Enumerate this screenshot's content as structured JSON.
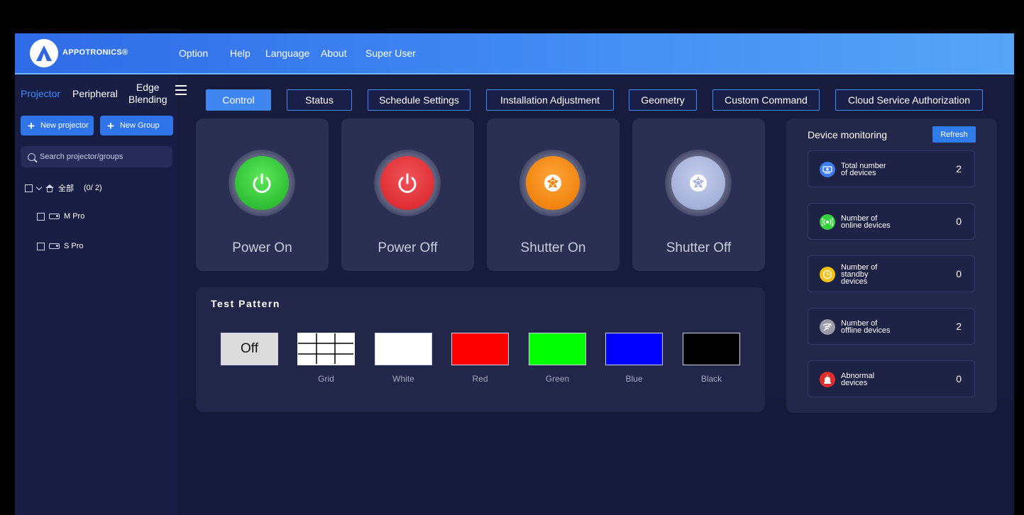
{
  "brand": {
    "name": "APPOTRONICS®"
  },
  "menu": [
    "Option",
    "Help",
    "Language",
    "About",
    "Super User"
  ],
  "sidebar": {
    "tabs": {
      "projector": "Projector",
      "peripheral": "Peripheral",
      "edge_1": "Edge",
      "edge_2": "Blending"
    },
    "new_projector": "New projector",
    "new_group": "New Group",
    "search_placeholder": "Search projector/groups",
    "tree": {
      "group_name": "全部",
      "group_count": "(0/ 2)",
      "items": [
        "M Pro",
        "S Pro"
      ]
    }
  },
  "nav_tabs": [
    "Control",
    "Status",
    "Schedule Settings",
    "Installation Adjustment",
    "Geometry",
    "Custom Command",
    "Cloud Service Authorization"
  ],
  "controls": [
    {
      "label": "Power On",
      "color": "#3ecf3e",
      "icon": "power-icon"
    },
    {
      "label": "Power Off",
      "color": "#e23a3a",
      "icon": "power-icon"
    },
    {
      "label": "Shutter On",
      "color": "#f08a12",
      "icon": "shutter-icon"
    },
    {
      "label": "Shutter Off",
      "color": "#aab6db",
      "icon": "shutter-icon"
    }
  ],
  "test_pattern": {
    "title": "Test Pattern",
    "off_label": "Off",
    "patterns": [
      {
        "label": "Grid",
        "color": "#ffffff"
      },
      {
        "label": "White",
        "color": "#ffffff"
      },
      {
        "label": "Red",
        "color": "#ff0000"
      },
      {
        "label": "Green",
        "color": "#00ff00"
      },
      {
        "label": "Blue",
        "color": "#0000ff"
      },
      {
        "label": "Black",
        "color": "#000000"
      }
    ]
  },
  "monitor": {
    "title": "Device monitoring",
    "refresh": "Refresh",
    "stats": [
      {
        "line1": "Total number",
        "line2": "of devices",
        "line3": "",
        "value": "2",
        "color": "#3d7cf0",
        "icon": "devices-icon"
      },
      {
        "line1": "Number of",
        "line2": "online devices",
        "line3": "",
        "value": "0",
        "color": "#36d13b",
        "icon": "signal-icon"
      },
      {
        "line1": "Number of",
        "line2": "standby",
        "line3": "devices",
        "value": "0",
        "color": "#f3c316",
        "icon": "clock-icon"
      },
      {
        "line1": "Number of",
        "line2": "offline devices",
        "line3": "",
        "value": "2",
        "color": "#9a9aa8",
        "icon": "wifi-off-icon"
      },
      {
        "line1": "Abnormal",
        "line2": "devices",
        "line3": "",
        "value": "0",
        "color": "#e22d2d",
        "icon": "alarm-icon"
      }
    ]
  }
}
